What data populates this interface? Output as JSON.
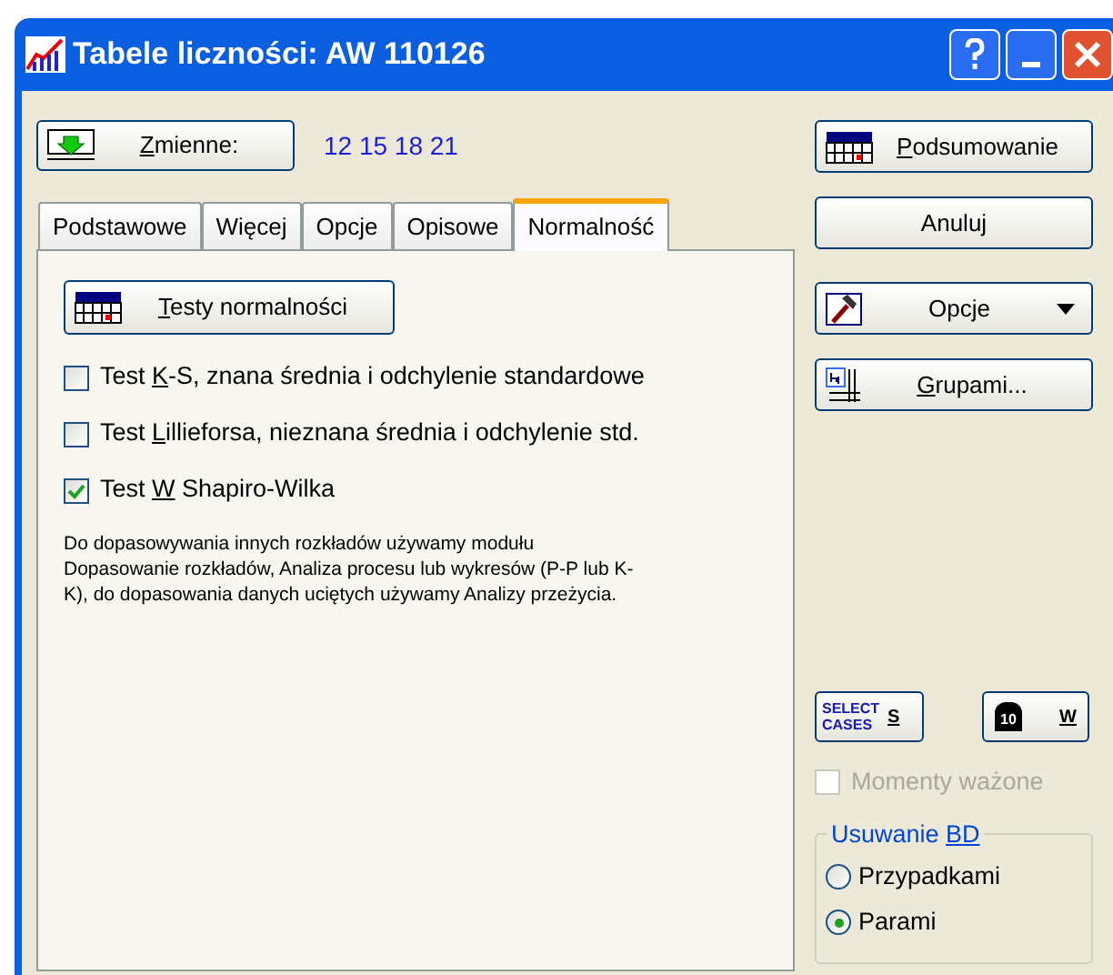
{
  "window": {
    "title": "Tabele liczności: AW 110126"
  },
  "variables_button": {
    "key": "Z",
    "after": "mienne:"
  },
  "variables": "12 15 18 21",
  "tabs": [
    {
      "label": "Podstawowe",
      "selected": false
    },
    {
      "label": "Więcej",
      "selected": false
    },
    {
      "label": "Opcje",
      "selected": false
    },
    {
      "label": "Opisowe",
      "selected": false
    },
    {
      "label": "Normalność",
      "selected": true
    }
  ],
  "tests_button": {
    "key": "T",
    "after": "esty normalności"
  },
  "checks": [
    {
      "before": "Test ",
      "key": "K",
      "after": "-S, znana średnia i odchylenie standardowe",
      "checked": false
    },
    {
      "before": "Test ",
      "key": "L",
      "after": "illieforsa, nieznana średnia i odchylenie std.",
      "checked": false
    },
    {
      "before": "Test ",
      "key": "W",
      "after": " Shapiro-Wilka",
      "checked": true
    }
  ],
  "note": "Do dopasowywania innych rozkładów używamy modułu Dopasowanie rozkładów, Analiza procesu lub wykresów (P-P lub K-K), do dopasowania danych uciętych używamy Analizy przeżycia.",
  "side_buttons": [
    {
      "kind": "summary",
      "key": "P",
      "after": "odsumowanie"
    },
    {
      "kind": "plain",
      "before": "Anuluj"
    },
    {
      "kind": "options",
      "before": "Opcje"
    },
    {
      "kind": "groups",
      "key": "G",
      "after": "rupami..."
    }
  ],
  "select_cases": {
    "icon_text": "SELECT CASES",
    "key": "S"
  },
  "weight": {
    "icon_text": "10",
    "key": "W"
  },
  "weighted_moments": {
    "label": "Momenty ważone",
    "checked": false,
    "disabled": true
  },
  "missing_group": {
    "before": "Usuwanie ",
    "key": "BD",
    "options": [
      {
        "label": "Przypadkami",
        "selected": false
      },
      {
        "label": "Parami",
        "selected": true
      }
    ]
  }
}
